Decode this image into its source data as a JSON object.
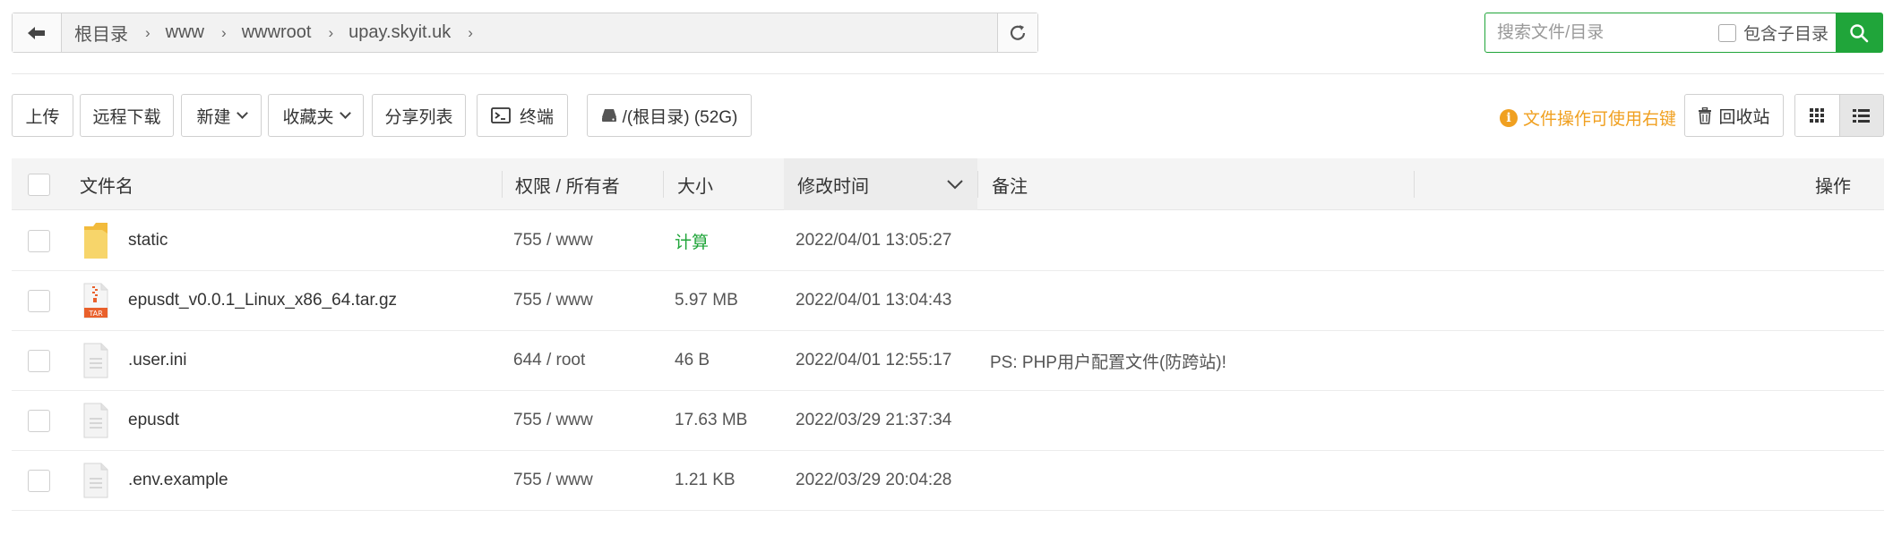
{
  "breadcrumb": [
    "根目录",
    "www",
    "wwwroot",
    "upay.skyit.uk"
  ],
  "search": {
    "placeholder": "搜索文件/目录",
    "subdir_label": "包含子目录"
  },
  "toolbar": {
    "upload": "上传",
    "remote_download": "远程下载",
    "new": "新建",
    "favorites": "收藏夹",
    "share_list": "分享列表",
    "terminal": "终端",
    "disk": "/(根目录) (52G)",
    "tip": "文件操作可使用右键",
    "recycle": "回收站"
  },
  "table": {
    "headers": {
      "name": "文件名",
      "perm": "权限 / 所有者",
      "size": "大小",
      "mtime": "修改时间",
      "note": "备注",
      "action": "操作"
    },
    "rows": [
      {
        "icon": "folder-icon",
        "name": "static",
        "perm": "755 / www",
        "size": "计算",
        "mtime": "2022/04/01 13:05:27",
        "note": ""
      },
      {
        "icon": "tar-archive-icon",
        "name": "epusdt_v0.0.1_Linux_x86_64.tar.gz",
        "perm": "755 / www",
        "size": "5.97 MB",
        "mtime": "2022/04/01 13:04:43",
        "note": ""
      },
      {
        "icon": "file-icon",
        "name": ".user.ini",
        "perm": "644 / root",
        "size": "46 B",
        "mtime": "2022/04/01 12:55:17",
        "note": "PS: PHP用户配置文件(防跨站)!"
      },
      {
        "icon": "file-icon",
        "name": "epusdt",
        "perm": "755 / www",
        "size": "17.63 MB",
        "mtime": "2022/03/29 21:37:34",
        "note": ""
      },
      {
        "icon": "file-icon",
        "name": ".env.example",
        "perm": "755 / www",
        "size": "1.21 KB",
        "mtime": "2022/03/29 20:04:28",
        "note": ""
      }
    ]
  },
  "colors": {
    "accent": "#20a53a",
    "tip": "#f0a020",
    "folder": "#f7c948"
  }
}
